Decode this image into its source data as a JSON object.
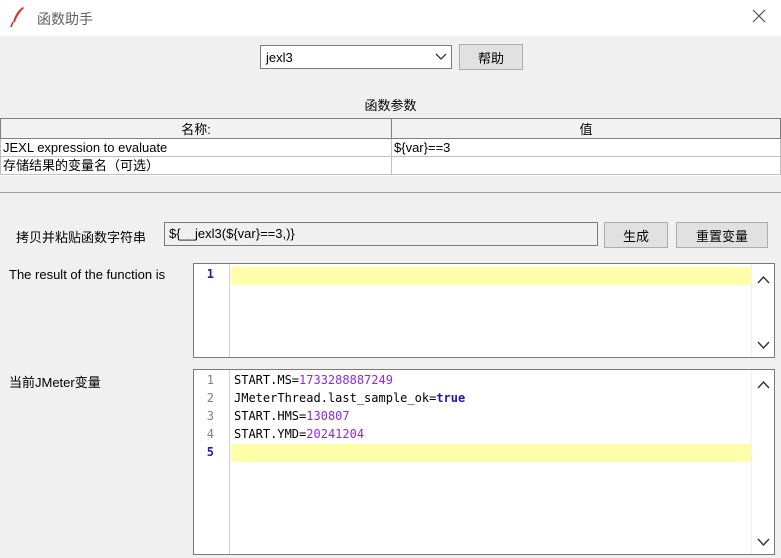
{
  "window": {
    "title": "函数助手",
    "close_icon": "close-icon",
    "app_icon": "feather-icon"
  },
  "toolbar": {
    "function_selected": "jexl3",
    "help_label": "帮助"
  },
  "params": {
    "section_title": "函数参数",
    "columns": [
      "名称:",
      "值"
    ],
    "rows": [
      {
        "name": "JEXL expression to evaluate",
        "value": "${var}==3"
      },
      {
        "name": "存储结果的变量名（可选）",
        "value": ""
      }
    ]
  },
  "copy": {
    "label": "拷贝并粘贴函数字符串",
    "value": "${__jexl3(${var}==3,)}",
    "generate_label": "生成",
    "reset_label": "重置变量"
  },
  "result": {
    "label": "The result of the function is",
    "line_numbers": [
      "1"
    ]
  },
  "variables": {
    "label": "当前JMeter变量",
    "line_numbers": [
      "1",
      "2",
      "3",
      "4",
      "5"
    ],
    "lines": [
      {
        "key": "START.MS",
        "value": "1733288887249"
      },
      {
        "key": "JMeterThread.last_sample_ok",
        "value": "true"
      },
      {
        "key": "START.HMS",
        "value": "130807"
      },
      {
        "key": "START.YMD",
        "value": "20241204"
      }
    ]
  },
  "colors": {
    "highlight": "#ffffaa",
    "number": "#8a2be2",
    "keyword": "#1a1aa6"
  }
}
